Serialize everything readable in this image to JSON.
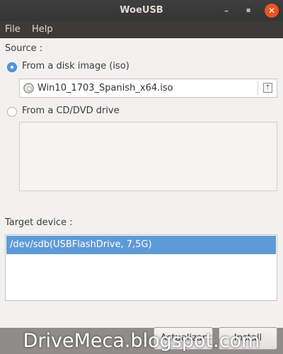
{
  "window": {
    "title": "WoeUSB",
    "minimize_glyph": "–",
    "maximize_glyph": "◾",
    "close_glyph": "✕"
  },
  "menu": {
    "items": [
      {
        "label": "File"
      },
      {
        "label": "Help"
      }
    ]
  },
  "source": {
    "heading": "Source :",
    "options": [
      {
        "label": "From a disk image (iso)",
        "selected": true
      },
      {
        "label": "From a CD/DVD drive",
        "selected": false
      }
    ],
    "iso_file": "Win10_1703_Spanish_x64.iso",
    "open_icon": "document-open-icon",
    "open_glyph": "⇡",
    "cd_drives": []
  },
  "target": {
    "heading": "Target device :",
    "devices": [
      {
        "label": "/dev/sdb(USBFlashDrive,  7,5G)",
        "selected": true
      }
    ]
  },
  "actions": {
    "refresh_label": "Actualizar",
    "install_label": "Install"
  },
  "watermark": "DriveMeca.blogspot.com",
  "colors": {
    "titlebar": "#3c3c3c",
    "selection": "#5f9ad8",
    "close_button": "#e95420",
    "radio_checked": "#5598d7"
  }
}
